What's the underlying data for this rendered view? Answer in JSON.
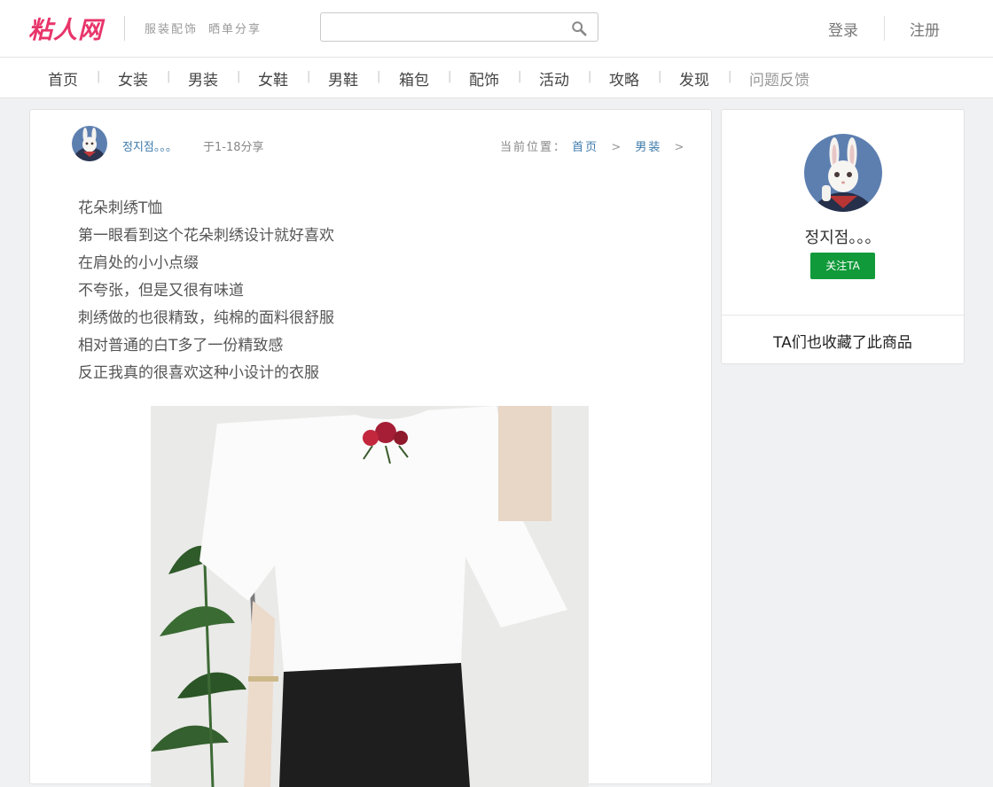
{
  "header": {
    "logo_text": "粘人网",
    "slogan_1": "服装配饰",
    "slogan_2": "晒单分享",
    "search_placeholder": "",
    "login_label": "登录",
    "register_label": "注册"
  },
  "nav": {
    "items": [
      "首页",
      "女装",
      "男装",
      "女鞋",
      "男鞋",
      "箱包",
      "配饰",
      "活动",
      "攻略",
      "发现",
      "问题反馈"
    ],
    "separator": "|"
  },
  "post": {
    "author_name": "정지점。。。",
    "share_date": "于1-18分享",
    "breadcrumb_label": "当前位置：",
    "breadcrumb_home": "首页",
    "breadcrumb_category": "男装",
    "breadcrumb_sep": ">",
    "lines": [
      "花朵刺绣T恤",
      "第一眼看到这个花朵刺绣设计就好喜欢",
      "在肩处的小小点缀",
      "不夸张，但是又很有味道",
      "刺绣做的也很精致，纯棉的面料很舒服",
      "相对普通的白T多了一份精致感",
      "反正我真的很喜欢这种小设计的衣服"
    ]
  },
  "sidebar": {
    "user_name": "정지점。。。",
    "follow_label": "关注TA",
    "section_title": "TA们也收藏了此商品"
  },
  "colors": {
    "brand": "#e8356a",
    "link": "#3e7bab",
    "follow_button": "#109a3a",
    "page_background": "#f0f1f3"
  },
  "icons": {
    "search": "search-icon"
  }
}
